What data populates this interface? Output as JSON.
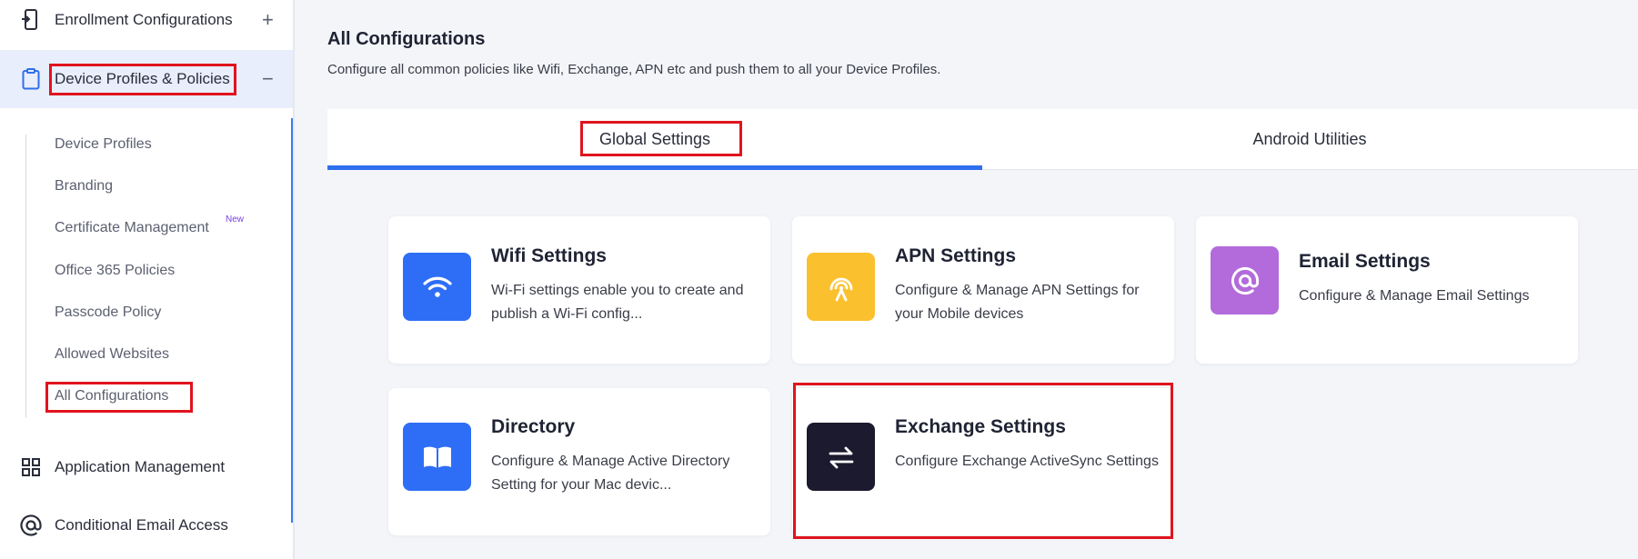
{
  "sidebar": {
    "enrollment": {
      "label": "Enrollment Configurations",
      "toggle": "+"
    },
    "device_profiles": {
      "label": "Device Profiles & Policies",
      "toggle": "−"
    },
    "sub_items": [
      {
        "label": "Device Profiles"
      },
      {
        "label": "Branding"
      },
      {
        "label": "Certificate Management",
        "badge": "New"
      },
      {
        "label": "Office 365 Policies"
      },
      {
        "label": "Passcode Policy"
      },
      {
        "label": "Allowed Websites"
      },
      {
        "label": "All Configurations"
      }
    ],
    "app_management": {
      "label": "Application Management"
    },
    "conditional_email": {
      "label": "Conditional Email Access"
    }
  },
  "main": {
    "title": "All Configurations",
    "description": "Configure all common policies like Wifi, Exchange, APN etc and push them to all your Device Profiles.",
    "tabs": [
      {
        "label": "Global Settings",
        "active": true
      },
      {
        "label": "Android Utilities",
        "active": false
      }
    ],
    "cards": [
      {
        "title": "Wifi Settings",
        "description": "Wi-Fi settings enable you to create and publish a Wi-Fi config...",
        "icon": "wifi-icon",
        "color": "#2e6ef7"
      },
      {
        "title": "APN Settings",
        "description": "Configure & Manage APN Settings for your Mobile devices",
        "icon": "antenna-icon",
        "color": "#fbc02d"
      },
      {
        "title": "Email Settings",
        "description": "Configure & Manage Email Settings",
        "icon": "at-sign-icon",
        "color": "#b36bdb"
      },
      {
        "title": "Directory",
        "description": "Configure & Manage Active Directory Setting for your Mac devic...",
        "icon": "book-icon",
        "color": "#2e6ef7"
      },
      {
        "title": "Exchange Settings",
        "description": "Configure Exchange ActiveSync Settings",
        "icon": "exchange-arrows-icon",
        "color": "#1c1a2e"
      }
    ]
  },
  "colors": {
    "accent": "#2f6fed",
    "highlight": "#e0141e",
    "active_nav_bg": "#e8eefc",
    "badge": "#7b3fe0"
  }
}
